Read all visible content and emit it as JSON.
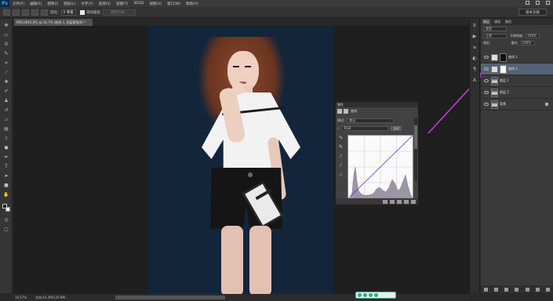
{
  "app": {
    "logo": "Ps",
    "menu": [
      "文件(F)",
      "编辑(E)",
      "图像(I)",
      "图层(L)",
      "文字(Y)",
      "选择(S)",
      "滤镜(T)",
      "3D(D)",
      "视图(V)",
      "窗口(W)",
      "帮助(H)"
    ]
  },
  "options": {
    "feather_label": "羽化:",
    "feather_value": "0 像素",
    "antialias_label": "消除锯齿",
    "refine_edge": "调整边缘...",
    "workspace": "基本功能"
  },
  "document": {
    "tab_title": "MEG3845.JPG @ 16.7% (曲线 1, 图层蒙版/8) *"
  },
  "curves": {
    "panel_title": "属性",
    "header_label": "曲线",
    "preset_label": "预设:",
    "preset_value": "默认",
    "channel_value": "RGB",
    "auto_button": "自动"
  },
  "layers": {
    "tabs": [
      "图层",
      "通道",
      "路径"
    ],
    "kind_value": "类型",
    "blend_value": "正常",
    "opacity_label": "不透明度:",
    "opacity_value": "100%",
    "fill_label": "填充:",
    "fill_value": "100%",
    "lock_label": "锁定:",
    "items": [
      {
        "name": "曲线 1"
      },
      {
        "name": "曲线 2"
      },
      {
        "name": "图层 1"
      },
      {
        "name": "图层 2"
      },
      {
        "name": "背景"
      }
    ]
  },
  "status": {
    "zoom": "16.67%",
    "doc_info": "文档:43.2M/120.8M"
  },
  "colors": {
    "accent_arrow": "#c83bd8",
    "canvas_bg": "#13253a",
    "selected_layer": "#566176"
  }
}
